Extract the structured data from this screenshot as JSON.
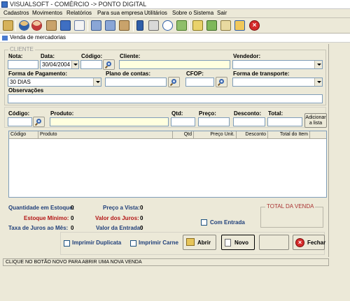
{
  "window": {
    "title": "VISUALSOFT - COMÉRCIO -> PONTO DIGITAL"
  },
  "menu": [
    "Cadastros",
    "Movimentos",
    "Relatórios",
    "Para sua empresa",
    "Utilitários",
    "Sobre o Sistema",
    "Sair"
  ],
  "child_window": {
    "title": "Venda de mercadorias"
  },
  "cliente_group": {
    "legend": "CLIENTE"
  },
  "form": {
    "nota_label": "Nota:",
    "data_label": "Data:",
    "data_value": "30/04/2004",
    "codigo_label": "Código:",
    "cliente_label": "Cliente:",
    "vendedor_label": "Vendedor:",
    "forma_pagamento_label": "Forma de Pagamento:",
    "forma_pagamento_value": "30 DIAS",
    "plano_contas_label": "Plano de contas:",
    "cfop_label": "CFOP:",
    "forma_transporte_label": "Forma de transporte:",
    "observacoes_label": "Observações"
  },
  "item_entry": {
    "codigo_label": "Código:",
    "produto_label": "Produto:",
    "qtd_label": "Qtd:",
    "preco_label": "Preço:",
    "desconto_label": "Desconto:",
    "total_label": "Total:",
    "add_button": "Adicionar a lista"
  },
  "grid": {
    "columns": [
      "Código",
      "Produto",
      "Qtd",
      "Preço Unit.",
      "Desconto",
      "Total do Item"
    ]
  },
  "summary": {
    "qtd_estoque_label": "Quantidade em Estoque:",
    "qtd_estoque_value": "0",
    "estoque_minimo_label": "Estoque Mínimo:",
    "estoque_minimo_value": "0",
    "taxa_juros_label": "Taxa de Juros ao Mês:",
    "taxa_juros_value": "0",
    "preco_vista_label": "Preço a Vista:",
    "preco_vista_value": "0",
    "valor_juros_label": "Valor dos Juros:",
    "valor_juros_value": "0",
    "valor_entrada_label": "Valor da Entrada:",
    "valor_entrada_value": "0",
    "com_entrada_label": "Com Entrada",
    "total_venda_label": "TOTAL DA VENDA"
  },
  "actions": {
    "imprimir_duplicata": "Imprimir Duplicata",
    "imprimir_carne": "Imprimir Carne",
    "abrir": "Abrir",
    "novo": "Novo",
    "fechar": "Fechar"
  },
  "status_bar": {
    "text": "CLIQUE NO BOTÃO NOVO PARA ABRIR UMA NOVA VENDA"
  },
  "colors": {
    "accent_blue": "#1f3f7a",
    "warning_red": "#b31414",
    "field_yellow": "#ffffdf"
  },
  "toolbar_icons": [
    "exit-door-icon",
    "users-icon",
    "user-icon",
    "box-icon",
    "cube-icon",
    "document-icon",
    "truck-icon",
    "truck-icon",
    "package-icon",
    "person-icon",
    "printer-icon",
    "chat-icon",
    "tools-icon",
    "keys-icon",
    "money-icon",
    "note-icon",
    "tags-icon",
    "close-icon"
  ]
}
